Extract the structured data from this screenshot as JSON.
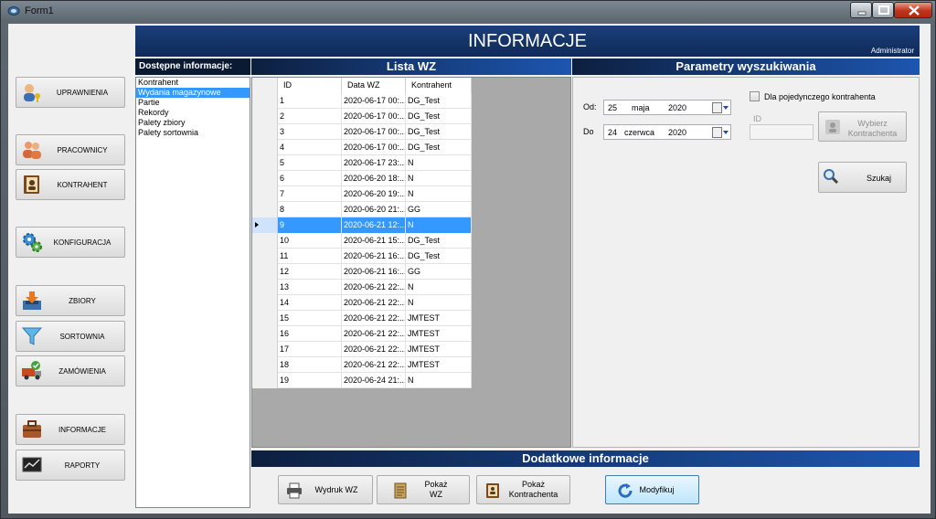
{
  "window": {
    "title": "Form1"
  },
  "nav": {
    "uprawnienia": "UPRAWNIENIA",
    "pracownicy": "PRACOWNICY",
    "kontrahent": "KONTRAHENT",
    "konfiguracja": "KONFIGURACJA",
    "zbiory": "ZBIORY",
    "sortownia": "SORTOWNIA",
    "zamowienia": "ZAMÓWIENIA",
    "informacje": "INFORMACJE",
    "raporty": "RAPORTY"
  },
  "header": {
    "title": "INFORMACJE",
    "user": "Administrator"
  },
  "available": {
    "heading": "Dostępne informacje:",
    "items": [
      "Kontrahent",
      "Wydania magazynowe",
      "Partie",
      "Rekordy",
      "Palety zbiory",
      "Palety sortownia"
    ],
    "selected_index": 1
  },
  "list": {
    "heading": "Lista WZ",
    "columns": [
      "ID",
      "Data WZ",
      "Kontrahent"
    ],
    "selected_row": 8,
    "rows": [
      [
        "1",
        "2020-06-17 00:...",
        "DG_Test"
      ],
      [
        "2",
        "2020-06-17 00:...",
        "DG_Test"
      ],
      [
        "3",
        "2020-06-17 00:...",
        "DG_Test"
      ],
      [
        "4",
        "2020-06-17 00:...",
        "DG_Test"
      ],
      [
        "5",
        "2020-06-17 23:...",
        "N"
      ],
      [
        "6",
        "2020-06-20 18:...",
        "N"
      ],
      [
        "7",
        "2020-06-20 19:...",
        "N"
      ],
      [
        "8",
        "2020-06-20 21:...",
        "GG"
      ],
      [
        "9",
        "2020-06-21 12:...",
        "N"
      ],
      [
        "10",
        "2020-06-21 15:...",
        "DG_Test"
      ],
      [
        "11",
        "2020-06-21 16:...",
        "DG_Test"
      ],
      [
        "12",
        "2020-06-21 16:...",
        "GG"
      ],
      [
        "13",
        "2020-06-21 22:...",
        "N"
      ],
      [
        "14",
        "2020-06-21 22:...",
        "N"
      ],
      [
        "15",
        "2020-06-21 22:...",
        "JMTEST"
      ],
      [
        "16",
        "2020-06-21 22:...",
        "JMTEST"
      ],
      [
        "17",
        "2020-06-21 22:...",
        "JMTEST"
      ],
      [
        "18",
        "2020-06-21 22:...",
        "JMTEST"
      ],
      [
        "19",
        "2020-06-24 21:...",
        "N"
      ]
    ]
  },
  "search": {
    "heading": "Parametry wyszukiwania",
    "from_label": "Od:",
    "from": {
      "day": "25",
      "month": "maja",
      "year": "2020"
    },
    "to_label": "Do",
    "to": {
      "day": "24",
      "month": "czerwca",
      "year": "2020"
    },
    "single_contractor_label": "Dla pojedynczego kontrahenta",
    "id_label": "ID",
    "choose_contractor": "Wybierz\nKontrachenta",
    "search_button": "Szukaj"
  },
  "extra": {
    "heading": "Dodatkowe informacje",
    "print_wz": "Wydruk WZ",
    "show_wz": "Pokaż\nWZ",
    "show_contractor": "Pokaż\nKontrachenta",
    "modify": "Modyfikuj"
  }
}
